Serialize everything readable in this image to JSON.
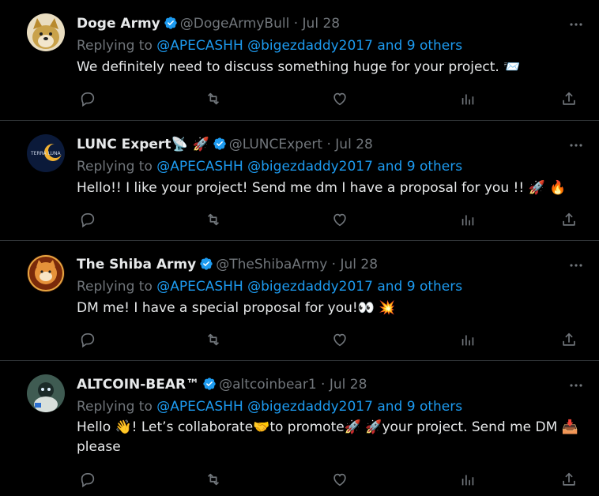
{
  "tweets": [
    {
      "name": "Doge Army",
      "handle": "@DogeArmyBull",
      "date": "Jul 28",
      "replying_prefix": "Replying to ",
      "replying_to": "@APECASHH @bigezdaddy2017 and 9 others",
      "text": "We definitely need to discuss something huge for your project. 📨"
    },
    {
      "name": "LUNC Expert📡 🚀",
      "handle": "@LUNCExpert",
      "date": "Jul 28",
      "replying_prefix": "Replying to ",
      "replying_to": "@APECASHH @bigezdaddy2017 and 9 others",
      "text": "Hello!! I like your project! Send me dm I have a proposal for you !! 🚀 🔥"
    },
    {
      "name": "The Shiba Army",
      "handle": "@TheShibaArmy",
      "date": "Jul 28",
      "replying_prefix": "Replying to ",
      "replying_to": "@APECASHH @bigezdaddy2017 and 9 others",
      "text": "DM me! I have a special proposal for you!👀 💥"
    },
    {
      "name": "ALTCOIN-BEAR™",
      "handle": "@altcoinbear1",
      "date": "Jul 28",
      "replying_prefix": "Replying to ",
      "replying_to": "@APECASHH @bigezdaddy2017 and 9 others",
      "text": "Hello 👋! Let’s collaborate🤝to promote🚀 🚀your project. Send me DM 📥please"
    }
  ],
  "avatar_labels": {
    "lunc": "TERRA LUNA"
  },
  "separator": " · ",
  "colors": {
    "background": "#000000",
    "text": "#e7e9ea",
    "secondary": "#71767b",
    "link": "#1d9bf0",
    "verified": "#1d9bf0"
  },
  "action_icons": [
    "reply-icon",
    "retweet-icon",
    "like-icon",
    "views-icon",
    "share-icon"
  ]
}
